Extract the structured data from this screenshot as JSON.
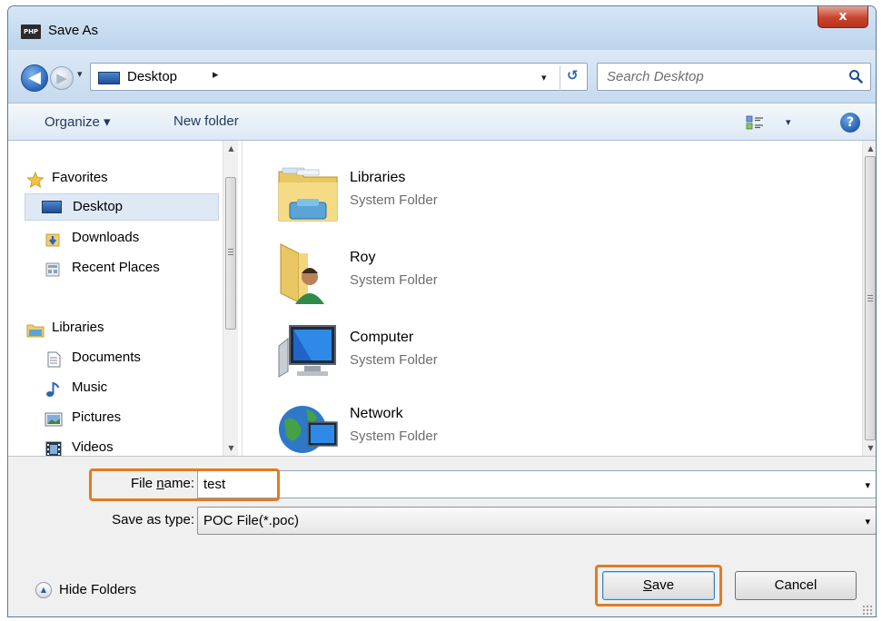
{
  "window": {
    "title": "Save As",
    "app_icon_text": "PHP",
    "close_label": "x"
  },
  "nav": {
    "back_glyph": "◀",
    "forward_glyph": "▶",
    "dropdown_glyph": "▾"
  },
  "address": {
    "location": "Desktop",
    "chevron": "▸",
    "dropdown_glyph": "▾",
    "refresh_glyph": "↺"
  },
  "search": {
    "placeholder": "Search Desktop"
  },
  "toolbar": {
    "organize_label": "Organize ▾",
    "new_folder_label": "New folder",
    "view_dropdown": "▾",
    "help_glyph": "?"
  },
  "sidebar": {
    "favorites": {
      "label": "Favorites",
      "items": [
        {
          "label": "Desktop"
        },
        {
          "label": "Downloads"
        },
        {
          "label": "Recent Places"
        }
      ]
    },
    "libraries": {
      "label": "Libraries",
      "items": [
        {
          "label": "Documents"
        },
        {
          "label": "Music"
        },
        {
          "label": "Pictures"
        },
        {
          "label": "Videos"
        }
      ]
    }
  },
  "items": [
    {
      "name": "Libraries",
      "kind": "System Folder"
    },
    {
      "name": "Roy",
      "kind": "System Folder"
    },
    {
      "name": "Computer",
      "kind": "System Folder"
    },
    {
      "name": "Network",
      "kind": "System Folder"
    }
  ],
  "form": {
    "file_name_label_pre": "File ",
    "file_name_label_u": "n",
    "file_name_label_post": "ame:",
    "file_name_value": "test",
    "save_type_label": "Save as type:",
    "save_type_value": "POC File(*.poc)",
    "dropdown_glyph": "▾"
  },
  "footer": {
    "hide_folders_label": "Hide Folders",
    "hide_glyph": "▲",
    "save_label_u": "S",
    "save_label_rest": "ave",
    "cancel_label": "Cancel"
  },
  "colors": {
    "highlight": "#e17b23",
    "accent": "#2a64b8"
  }
}
